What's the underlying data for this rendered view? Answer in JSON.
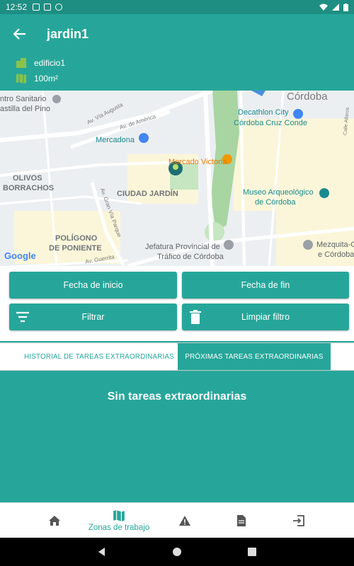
{
  "status_bar": {
    "time": "12:52"
  },
  "app_bar": {
    "title": "jardin1"
  },
  "info": {
    "building": "edificio1",
    "area": "100m²"
  },
  "map": {
    "labels": {
      "centro_sanitario": "ntro Sanitario",
      "castilla": "astilla del Pino",
      "cordoba": "Córdoba",
      "decathlon": "Decathlon City",
      "cordoba_cruz": "Córdoba Cruz Conde",
      "mercadona": "Mercadona",
      "mercado": "Mercado Victoria",
      "olivos": "OLIVOS",
      "borrachos": "BORRACHOS",
      "ciudad_jardin": "CIUDAD JARDÍN",
      "museo": "Museo Arqueológico",
      "de_cordoba": "de Córdoba",
      "poligono": "POLÍGONO",
      "de_poniente": "DE PONIENTE",
      "jefatura": "Jefatura Provincial de",
      "trafico": "Tráfico de Córdoba",
      "mezquita": "Mezquita-C",
      "de_cordoba2": "e Córdoba",
      "av_augusta": "Av. Vía Augusta",
      "av_america": "Av. de América",
      "av_parque": "Av. Gran Vía Parque",
      "av_guerrita": "Av. Guerrita",
      "calle_alfaros": "Calle Alfaros",
      "google": "Google"
    }
  },
  "buttons": {
    "fecha_inicio": "Fecha de inicio",
    "fecha_fin": "Fecha de fin",
    "filtrar": "Filtrar",
    "limpiar": "Limpiar filtro"
  },
  "tabs": {
    "historial": "HISTORIAL DE TAREAS EXTRAORDINARIAS",
    "proximas": "PRÓXIMAS TAREAS EXTRAORDINARIAS"
  },
  "content": {
    "empty_message": "Sin tareas extraordinarias"
  },
  "bottom_nav": {
    "zonas": "Zonas de trabajo"
  },
  "colors": {
    "primary": "#26a69a",
    "status": "#1e8e83",
    "map_bg": "#eceff1"
  }
}
